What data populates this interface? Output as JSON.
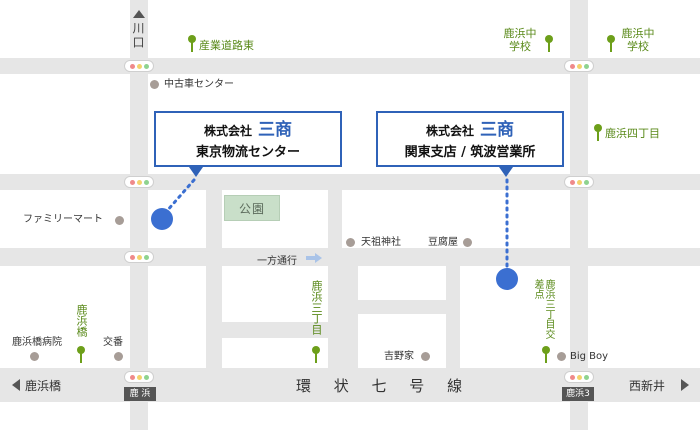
{
  "roads": {
    "main_road": "環 状 七 号 線",
    "left_destination": "鹿浜橋",
    "right_destination": "西新井",
    "top_destination": "川口",
    "one_way": "一方通行"
  },
  "plates": {
    "left": "鹿 浜",
    "right": "鹿浜3"
  },
  "callouts": {
    "tokyo": {
      "company": "株式会社",
      "brand": "三商",
      "office": "東京物流センター"
    },
    "kanto": {
      "company": "株式会社",
      "brand": "三商",
      "office": "関東支店 / 筑波営業所"
    }
  },
  "park": {
    "label": "公園"
  },
  "landmarks": {
    "used_car_center": "中古車センター",
    "family_mart": "ファミリーマート",
    "tenso_shrine": "天祖神社",
    "tofu_shop": "豆腐屋",
    "kitano_house": "吉野家",
    "big_boy": "Big Boy",
    "hospital": "鹿浜橋病院",
    "koban": "交番"
  },
  "intersections": {
    "sangyo_road_east": "産業道路東",
    "shikahama_jhs_1": "鹿浜中学校",
    "shikahama_jhs_2": "鹿浜中学校",
    "shikahama_4": "鹿浜四丁目",
    "shikahama_3": "鹿浜三丁目",
    "shikahama_3_crossing": "鹿浜三丁目交差点",
    "shikahama_bridge": "鹿浜橋"
  },
  "colors": {
    "accent_blue": "#2f62b8",
    "location_dot": "#3b6fd1",
    "signal_pin": "#6d9f1a",
    "park_green": "#c9dfc9"
  }
}
